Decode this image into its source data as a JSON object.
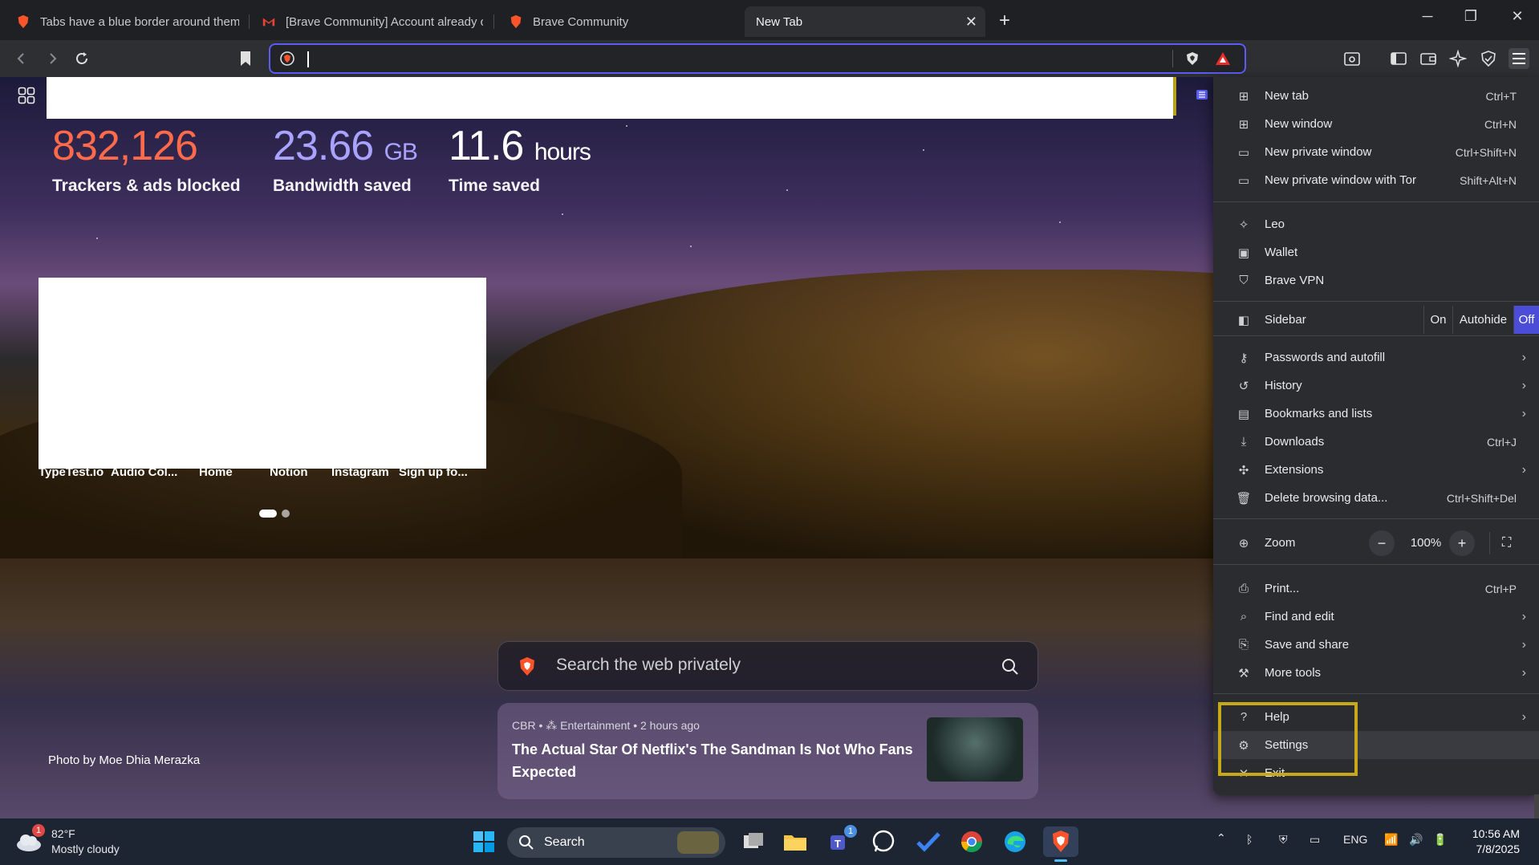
{
  "tabs": [
    {
      "title": "Tabs have a blue border around them",
      "favicon": "brave-lion-icon"
    },
    {
      "title": "[Brave Community] Account already c",
      "favicon": "gmail-icon"
    },
    {
      "title": "Brave Community",
      "favicon": "brave-lion-icon"
    },
    {
      "title": "New Tab",
      "active": true
    }
  ],
  "address_bar": {
    "value": ""
  },
  "stats": {
    "trackers": {
      "value": "832,126",
      "label": "Trackers & ads blocked",
      "color": "#ff6b4a"
    },
    "bandwidth": {
      "value": "23.66",
      "unit": "GB",
      "label": "Bandwidth saved",
      "color": "#a9a3ff"
    },
    "time": {
      "value": "11.6",
      "unit": "hours",
      "label": "Time saved",
      "color": "#ffffff"
    }
  },
  "top_sites": [
    "TypeTest.io",
    "Audio Col...",
    "Home",
    "Notion",
    "Instagram",
    "Sign up fo..."
  ],
  "search": {
    "placeholder": "Search the web privately"
  },
  "news": {
    "source": "CBR",
    "category": "Entertainment",
    "time": "2 hours ago",
    "headline": "The Actual Star Of Netflix's The Sandman Is Not Who Fans Expected"
  },
  "photo_credit": "Photo by Moe Dhia Merazka",
  "menu": {
    "group1": [
      {
        "label": "New tab",
        "shortcut": "Ctrl+T",
        "icon": "new-tab-icon"
      },
      {
        "label": "New window",
        "shortcut": "Ctrl+N",
        "icon": "new-window-icon"
      },
      {
        "label": "New private window",
        "shortcut": "Ctrl+Shift+N",
        "icon": "private-window-icon"
      },
      {
        "label": "New private window with Tor",
        "shortcut": "Shift+Alt+N",
        "icon": "tor-window-icon"
      }
    ],
    "group2": [
      {
        "label": "Leo",
        "icon": "leo-icon"
      },
      {
        "label": "Wallet",
        "icon": "wallet-icon"
      },
      {
        "label": "Brave VPN",
        "icon": "vpn-icon"
      }
    ],
    "sidebar": {
      "label": "Sidebar",
      "options": [
        "On",
        "Autohide",
        "Off"
      ],
      "selected": "Off"
    },
    "group3": [
      {
        "label": "Passwords and autofill",
        "icon": "key-icon",
        "submenu": true
      },
      {
        "label": "History",
        "icon": "history-icon",
        "submenu": true
      },
      {
        "label": "Bookmarks and lists",
        "icon": "bookmarks-icon",
        "submenu": true
      },
      {
        "label": "Downloads",
        "shortcut": "Ctrl+J",
        "icon": "download-icon"
      },
      {
        "label": "Extensions",
        "icon": "extensions-icon",
        "submenu": true
      },
      {
        "label": "Delete browsing data...",
        "shortcut": "Ctrl+Shift+Del",
        "icon": "trash-icon"
      }
    ],
    "zoom": {
      "label": "Zoom",
      "value": "100%"
    },
    "group4": [
      {
        "label": "Print...",
        "shortcut": "Ctrl+P",
        "icon": "print-icon"
      },
      {
        "label": "Find and edit",
        "icon": "find-icon",
        "submenu": true
      },
      {
        "label": "Save and share",
        "icon": "save-icon",
        "submenu": true
      },
      {
        "label": "More tools",
        "icon": "tools-icon",
        "submenu": true
      }
    ],
    "group5": [
      {
        "label": "Help",
        "icon": "help-icon",
        "submenu": true
      },
      {
        "label": "Settings",
        "icon": "gear-icon"
      },
      {
        "label": "Exit",
        "icon": "close-icon"
      }
    ]
  },
  "taskbar": {
    "weather": {
      "temp": "82°F",
      "condition": "Mostly cloudy",
      "badge": "1"
    },
    "search_label": "Search",
    "teams_badge": "1",
    "language": "ENG",
    "time": "10:56 AM",
    "date": "7/8/2025"
  },
  "colors": {
    "accent": "#5b5cf6",
    "highlight_box": "#c6a81a",
    "sidebar_off": "#4b4cd8"
  }
}
